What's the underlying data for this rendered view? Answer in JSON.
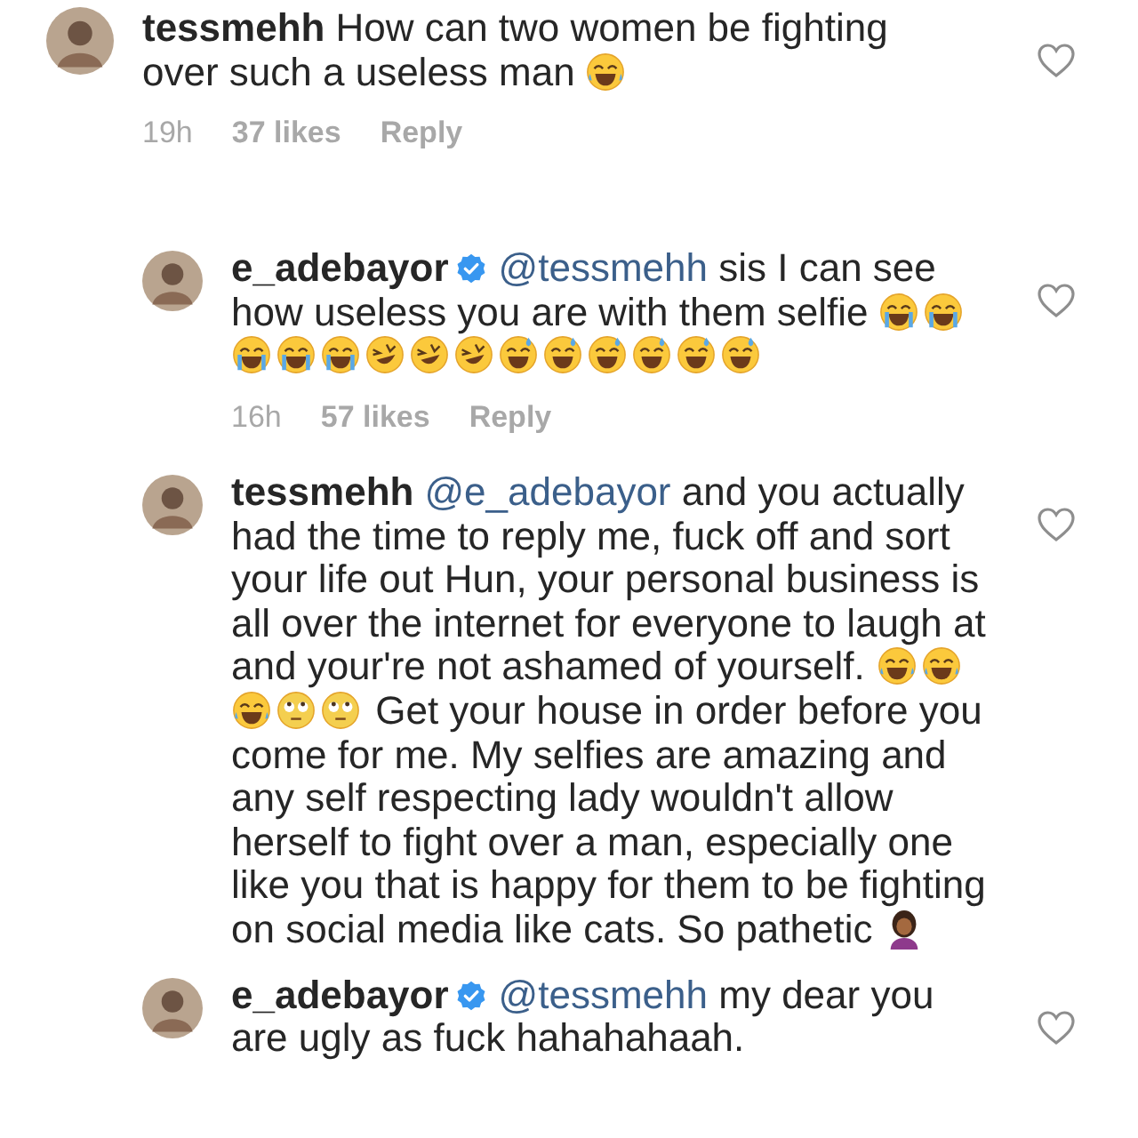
{
  "comments": [
    {
      "username": "tessmehh",
      "verified": false,
      "is_reply": false,
      "body": [
        {
          "kind": "text",
          "text": "How can two women be fighting over such a useless man "
        },
        {
          "kind": "joy"
        }
      ],
      "meta": {
        "time": "19h",
        "likes": "37 likes",
        "reply": "Reply"
      }
    },
    {
      "username": "e_adebayor",
      "verified": true,
      "is_reply": true,
      "body": [
        {
          "kind": "mention",
          "text": "@tessmehh"
        },
        {
          "kind": "text",
          "text": " sis I can see how useless you are with them selfie "
        },
        {
          "kind": "sob"
        },
        {
          "kind": "sob"
        },
        {
          "kind": "sob"
        },
        {
          "kind": "sob"
        },
        {
          "kind": "sob"
        },
        {
          "kind": "rofl"
        },
        {
          "kind": "rofl"
        },
        {
          "kind": "rofl"
        },
        {
          "kind": "sweat"
        },
        {
          "kind": "sweat"
        },
        {
          "kind": "sweat"
        },
        {
          "kind": "sweat"
        },
        {
          "kind": "sweat"
        },
        {
          "kind": "sweat"
        }
      ],
      "meta": {
        "time": "16h",
        "likes": "57 likes",
        "reply": "Reply"
      }
    },
    {
      "username": "tessmehh",
      "verified": false,
      "is_reply": true,
      "body": [
        {
          "kind": "mention",
          "text": "@e_adebayor"
        },
        {
          "kind": "text",
          "text": " and you actually had the time to reply me, fuck off and sort your life out Hun, your personal business is all over the internet for everyone to laugh at and your're not ashamed of yourself. "
        },
        {
          "kind": "joy"
        },
        {
          "kind": "joy"
        },
        {
          "kind": "joy"
        },
        {
          "kind": "eyeroll"
        },
        {
          "kind": "eyeroll"
        },
        {
          "kind": "text",
          "text": " Get your house in order before you come for me. My selfies are amazing and any self respecting lady wouldn't allow herself to fight over a man, especially one like you that is happy for them to be fighting on social media like cats. So pathetic "
        },
        {
          "kind": "facepalm"
        }
      ]
    },
    {
      "username": "e_adebayor",
      "verified": true,
      "is_reply": true,
      "body": [
        {
          "kind": "mention",
          "text": "@tessmehh"
        },
        {
          "kind": "text",
          "text": " my dear you are ugly as fuck hahahahaah."
        }
      ]
    }
  ]
}
